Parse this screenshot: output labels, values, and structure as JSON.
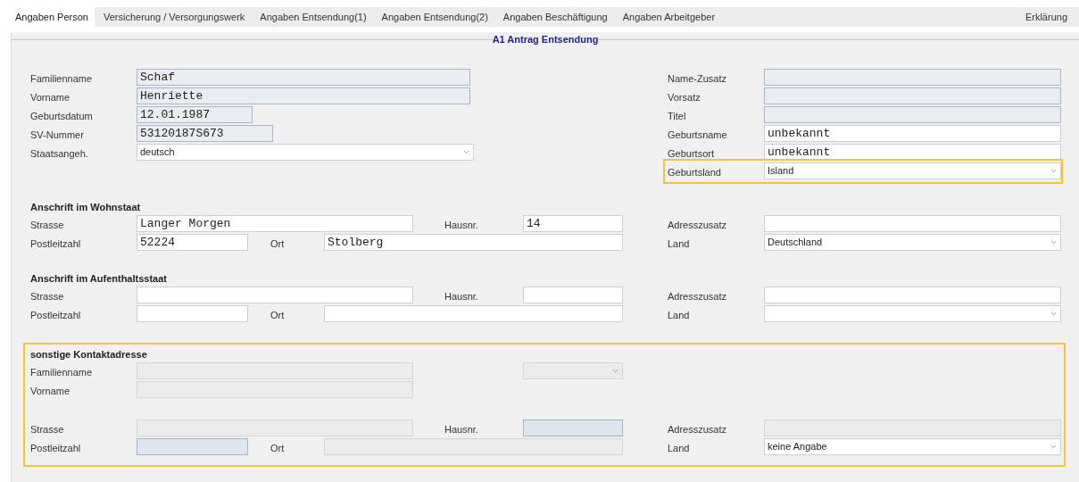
{
  "tabs": [
    {
      "label": "Angaben Person",
      "selected": true
    },
    {
      "label": "Versicherung / Versorgungswerk",
      "selected": false
    },
    {
      "label": "Angaben Entsendung(1)",
      "selected": false
    },
    {
      "label": "Angaben Entsendung(2)",
      "selected": false
    },
    {
      "label": "Angaben Beschäftigung",
      "selected": false
    },
    {
      "label": "Angaben Arbeitgeber",
      "selected": false
    },
    {
      "label": "Erklärung",
      "selected": false
    }
  ],
  "form": {
    "title": "A1 Antrag Entsendung",
    "sections": [
      {
        "kind": "person",
        "rows": [
          {
            "left": [
              {
                "label": "Familienname",
                "kind": "text",
                "value": "Schaf",
                "read_only": true,
                "disabled": false
              }
            ],
            "right": {
              "label": "Name-Zusatz",
              "kind": "text",
              "read_only": true,
              "disabled": false
            }
          },
          {
            "left": [
              {
                "label": "Vorname",
                "kind": "text",
                "value": "Henriette",
                "read_only": true,
                "disabled": false
              }
            ],
            "right": {
              "label": "Vorsatz",
              "kind": "text",
              "read_only": true,
              "disabled": false
            }
          },
          {
            "left": [
              {
                "label": "Geburtsdatum",
                "kind": "text",
                "value": "12.01.1987",
                "read_only": true,
                "disabled": false
              }
            ],
            "right": {
              "label": "Titel",
              "kind": "text",
              "read_only": true,
              "disabled": false
            }
          },
          {
            "left": [
              {
                "label": "SV-Nummer",
                "kind": "text",
                "value": "53120187S673",
                "read_only": true,
                "disabled": false
              }
            ],
            "right": {
              "label": "Geburtsname",
              "kind": "text",
              "value": "unbekannt",
              "read_only": false,
              "disabled": false
            }
          },
          {
            "left": [
              {
                "label": "Staatsangeh.",
                "kind": "select",
                "value": "deutsch",
                "read_only": false,
                "disabled": false
              }
            ],
            "right": {
              "label": "Geburtsort",
              "kind": "text",
              "value": "unbekannt",
              "read_only": false,
              "disabled": false
            }
          },
          {
            "right": {
              "label": "Geburtsland",
              "kind": "select",
              "value": "Island",
              "read_only": false,
              "disabled": false,
              "highlighted": true
            }
          }
        ]
      },
      {
        "kind": "address",
        "title": "Anschrift im Wohnstaat",
        "rows": [
          {
            "left": [
              {
                "label": "Strasse",
                "kind": "text",
                "value": "Langer Morgen",
                "read_only": false,
                "disabled": false
              },
              {
                "label": "Hausnr.",
                "kind": "text",
                "value": "14",
                "read_only": false,
                "disabled": false
              }
            ],
            "right": {
              "label": "Adresszusatz",
              "kind": "text",
              "read_only": false,
              "disabled": false
            }
          },
          {
            "left": [
              {
                "label": "Postleitzahl",
                "kind": "text",
                "value": "52224",
                "read_only": false,
                "disabled": false
              },
              {
                "label": "Ort",
                "kind": "text",
                "value": "Stolberg",
                "read_only": false,
                "disabled": false
              }
            ],
            "right": {
              "label": "Land",
              "kind": "select",
              "value": "Deutschland",
              "read_only": false,
              "disabled": false
            }
          }
        ]
      },
      {
        "kind": "address",
        "title": "Anschrift im Aufenthaltsstaat",
        "rows": [
          {
            "left": [
              {
                "label": "Strasse",
                "kind": "text",
                "read_only": false,
                "disabled": false
              },
              {
                "label": "Hausnr.",
                "kind": "text",
                "read_only": false,
                "disabled": false
              }
            ],
            "right": {
              "label": "Adresszusatz",
              "kind": "text",
              "read_only": false,
              "disabled": false
            }
          },
          {
            "left": [
              {
                "label": "Postleitzahl",
                "kind": "text",
                "read_only": false,
                "disabled": false
              },
              {
                "label": "Ort",
                "kind": "text",
                "read_only": false,
                "disabled": false
              }
            ],
            "right": {
              "label": "Land",
              "kind": "select",
              "read_only": false,
              "disabled": false
            }
          }
        ]
      },
      {
        "kind": "contact",
        "title": "sonstige Kontaktadresse",
        "highlighted": true,
        "rows": [
          {
            "left": [
              {
                "label": "Familienname",
                "kind": "text",
                "read_only": false,
                "disabled": true
              },
              {
                "kind": "select",
                "read_only": false,
                "disabled": true
              }
            ]
          },
          {
            "left": [
              {
                "label": "Vorname",
                "kind": "text",
                "read_only": false,
                "disabled": true
              }
            ]
          },
          {
            "left": [
              {
                "label": "Strasse",
                "kind": "text",
                "read_only": false,
                "disabled": true
              },
              {
                "label": "Hausnr.",
                "kind": "text",
                "read_only": true,
                "disabled": true
              }
            ],
            "right": {
              "label": "Adresszusatz",
              "kind": "text",
              "read_only": false,
              "disabled": true
            }
          },
          {
            "left": [
              {
                "label": "Postleitzahl",
                "kind": "text",
                "read_only": true,
                "disabled": true
              },
              {
                "label": "Ort",
                "kind": "text",
                "read_only": false,
                "disabled": true
              }
            ],
            "right": {
              "label": "Land",
              "kind": "select",
              "value": "keine Angabe",
              "read_only": false,
              "disabled": false
            }
          }
        ]
      }
    ]
  }
}
